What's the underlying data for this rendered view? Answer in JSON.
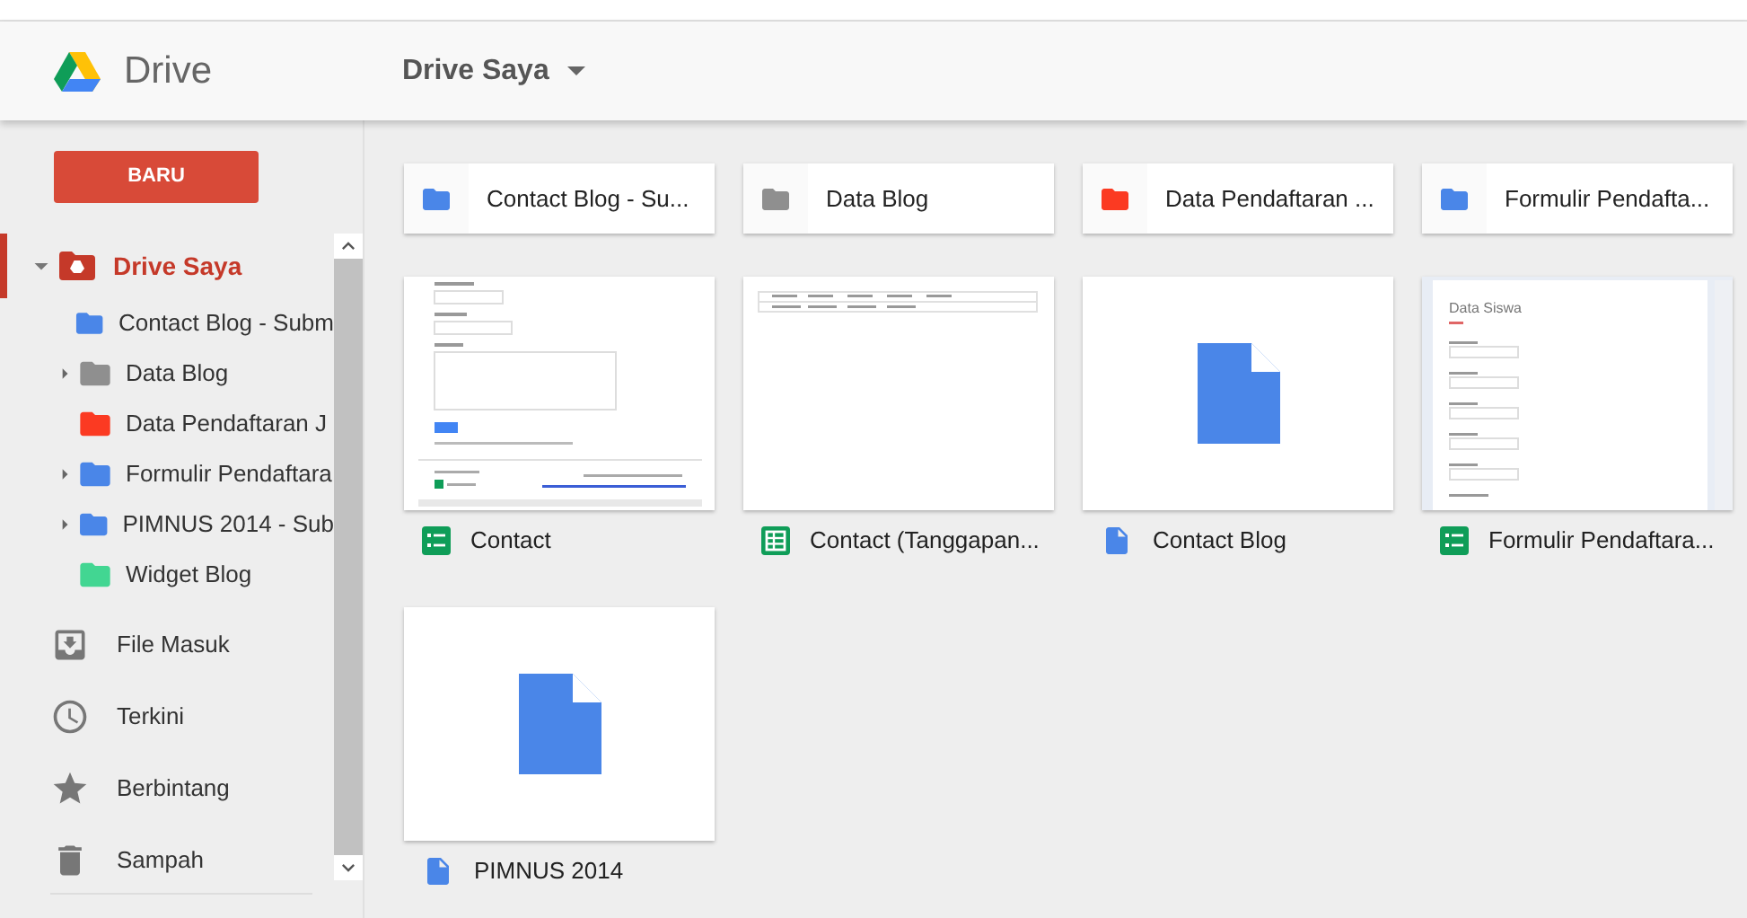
{
  "header": {
    "app_name": "Drive",
    "location": "Drive Saya"
  },
  "sidebar": {
    "new_button": "BARU",
    "tree": {
      "label": "Drive Saya",
      "expanded": true,
      "selected": true,
      "children": [
        {
          "label": "Contact Blog - Subm",
          "color": "#4a86e8",
          "has_children": false
        },
        {
          "label": "Data Blog",
          "color": "#8f8f8f",
          "has_children": true
        },
        {
          "label": "Data Pendaftaran J",
          "color": "#fb3a22",
          "has_children": false
        },
        {
          "label": "Formulir Pendaftara",
          "color": "#4a86e8",
          "has_children": true
        },
        {
          "label": "PIMNUS 2014 - Sub",
          "color": "#4a86e8",
          "has_children": true
        },
        {
          "label": "Widget Blog",
          "color": "#42d692",
          "has_children": false
        }
      ]
    },
    "nav": [
      {
        "label": "File Masuk"
      },
      {
        "label": "Terkini"
      },
      {
        "label": "Berbintang"
      },
      {
        "label": "Sampah"
      }
    ]
  },
  "folders": [
    {
      "name": "Contact Blog - Su...",
      "color": "#4a86e8"
    },
    {
      "name": "Data Blog",
      "color": "#8f8f8f"
    },
    {
      "name": "Data Pendaftaran ...",
      "color": "#fb3a22"
    },
    {
      "name": "Formulir Pendafta...",
      "color": "#4a86e8"
    }
  ],
  "files": [
    {
      "name": "Contact",
      "kind": "form"
    },
    {
      "name": "Contact (Tanggapan...",
      "kind": "sheet"
    },
    {
      "name": "Contact Blog",
      "kind": "doc"
    },
    {
      "name": "Formulir Pendaftara...",
      "kind": "form",
      "preview_title": "Data Siswa"
    },
    {
      "name": "PIMNUS 2014",
      "kind": "doc"
    }
  ]
}
